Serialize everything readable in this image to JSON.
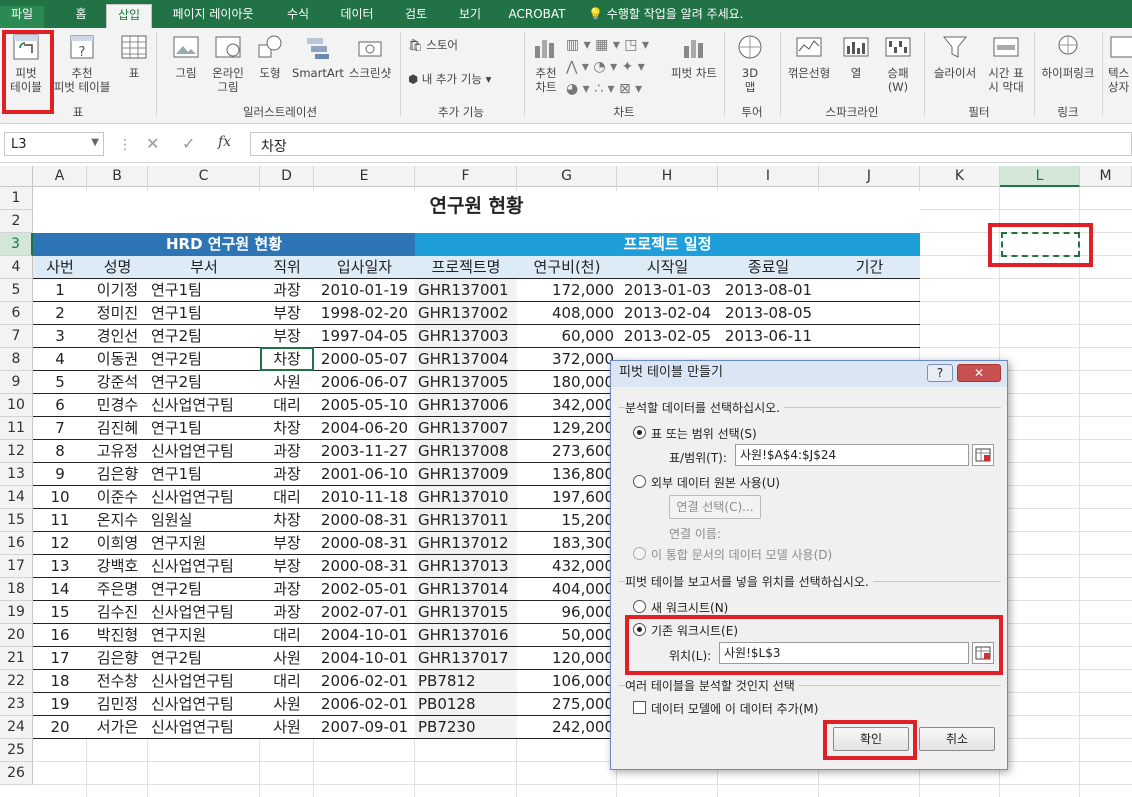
{
  "ribbon_tabs": [
    "파일",
    "홈",
    "삽입",
    "페이지 레이아웃",
    "수식",
    "데이터",
    "검토",
    "보기",
    "ACROBAT"
  ],
  "tell_me": "수행할 작업을 알려 주세요.",
  "ribbon": {
    "pivot": [
      "피벗",
      "테이블"
    ],
    "rec_pivot": [
      "추천",
      "피벗 테이블"
    ],
    "table": "표",
    "picture": "그림",
    "online_picture": [
      "온라인",
      "그림"
    ],
    "shapes": "도형",
    "smartart": "SmartArt",
    "screenshot": "스크린샷",
    "store": "스토어",
    "my_addins": "내 추가 기능",
    "rec_chart": [
      "추천",
      "차트"
    ],
    "pivot_chart": "피벗 차트",
    "map3d": [
      "3D",
      "맵"
    ],
    "spark_line": "꺾은선형",
    "spark_col": "열",
    "spark_wl": [
      "승패",
      "(W)"
    ],
    "slicer": "슬라이서",
    "timeline": [
      "시간 표",
      "시 막대"
    ],
    "hyperlink": "하이퍼링크",
    "text": [
      "텍스",
      "상자"
    ],
    "groups": {
      "tables": "표",
      "illustrations": "일러스트레이션",
      "addins": "추가 기능",
      "charts": "차트",
      "tours": "투어",
      "sparklines": "스파크라인",
      "filters": "필터",
      "links": "링크"
    }
  },
  "formula_bar": {
    "name_box": "L3",
    "formula": "차장"
  },
  "columns": [
    "A",
    "B",
    "C",
    "D",
    "E",
    "F",
    "G",
    "H",
    "I",
    "J",
    "K",
    "L",
    "M"
  ],
  "rows": [
    "1",
    "2",
    "3",
    "4",
    "5",
    "6",
    "7",
    "8",
    "9",
    "10",
    "11",
    "12",
    "13",
    "14",
    "15",
    "16",
    "17",
    "18",
    "19",
    "20",
    "21",
    "22",
    "23",
    "24",
    "25",
    "26"
  ],
  "sheet": {
    "title": "연구원 현황",
    "group_header_left": "HRD 연구원 현황",
    "group_header_right": "프로젝트 일정",
    "headers": [
      "사번",
      "성명",
      "부서",
      "직위",
      "입사일자",
      "프로젝트명",
      "연구비(천)",
      "시작일",
      "종료일",
      "기간"
    ],
    "rows": [
      [
        "1",
        "이기정",
        "연구1팀",
        "과장",
        "2010-01-19",
        "GHR137001",
        "172,000",
        "2013-01-03",
        "2013-08-01"
      ],
      [
        "2",
        "정미진",
        "연구1팀",
        "부장",
        "1998-02-20",
        "GHR137002",
        "408,000",
        "2013-02-04",
        "2013-08-05"
      ],
      [
        "3",
        "경인선",
        "연구2팀",
        "부장",
        "1997-04-05",
        "GHR137003",
        "60,000",
        "2013-02-05",
        "2013-06-11"
      ],
      [
        "4",
        "이동권",
        "연구2팀",
        "차장",
        "2000-05-07",
        "GHR137004",
        "372,000",
        "",
        ""
      ],
      [
        "5",
        "강준석",
        "연구2팀",
        "사원",
        "2006-06-07",
        "GHR137005",
        "180,000",
        "",
        ""
      ],
      [
        "6",
        "민경수",
        "신사업연구팀",
        "대리",
        "2005-05-10",
        "GHR137006",
        "342,000",
        "",
        ""
      ],
      [
        "7",
        "김진혜",
        "연구1팀",
        "차장",
        "2004-06-20",
        "GHR137007",
        "129,200",
        "",
        ""
      ],
      [
        "8",
        "고유정",
        "신사업연구팀",
        "과장",
        "2003-11-27",
        "GHR137008",
        "273,600",
        "",
        ""
      ],
      [
        "9",
        "김은향",
        "연구1팀",
        "과장",
        "2001-06-10",
        "GHR137009",
        "136,800",
        "",
        ""
      ],
      [
        "10",
        "이준수",
        "신사업연구팀",
        "대리",
        "2010-11-18",
        "GHR137010",
        "197,600",
        "",
        ""
      ],
      [
        "11",
        "온지수",
        "임원실",
        "차장",
        "2000-08-31",
        "GHR137011",
        "15,200",
        "",
        ""
      ],
      [
        "12",
        "이희영",
        "연구지원",
        "부장",
        "2000-08-31",
        "GHR137012",
        "183,300",
        "",
        ""
      ],
      [
        "13",
        "강백호",
        "신사업연구팀",
        "부장",
        "2000-08-31",
        "GHR137013",
        "432,000",
        "",
        ""
      ],
      [
        "14",
        "주은명",
        "연구2팀",
        "과장",
        "2002-05-01",
        "GHR137014",
        "404,000",
        "",
        ""
      ],
      [
        "15",
        "김수진",
        "신사업연구팀",
        "과장",
        "2002-07-01",
        "GHR137015",
        "96,000",
        "",
        ""
      ],
      [
        "16",
        "박진형",
        "연구지원",
        "대리",
        "2004-10-01",
        "GHR137016",
        "50,000",
        "",
        ""
      ],
      [
        "17",
        "김은향",
        "연구2팀",
        "사원",
        "2004-10-01",
        "GHR137017",
        "120,000",
        "",
        ""
      ],
      [
        "18",
        "전수창",
        "신사업연구팀",
        "대리",
        "2006-02-01",
        "PB7812",
        "106,000",
        "",
        ""
      ],
      [
        "19",
        "김민정",
        "신사업연구팀",
        "사원",
        "2006-02-01",
        "PB0128",
        "275,000",
        "",
        ""
      ],
      [
        "20",
        "서가은",
        "신사업연구팀",
        "사원",
        "2007-09-01",
        "PB7230",
        "242,000",
        "",
        ""
      ]
    ]
  },
  "dialog": {
    "title": "피벗 테이블 만들기",
    "section1": "분석할 데이터를 선택하십시오.",
    "opt_range": "표 또는 범위 선택(S)",
    "range_label": "표/범위(T):",
    "range_value": "사원!$A$4:$J$24",
    "opt_external": "외부 데이터 원본 사용(U)",
    "conn_button": "연결 선택(C)...",
    "conn_name": "연결 이름:",
    "opt_model": "이 통합 문서의 데이터 모델 사용(D)",
    "section2": "피벗 테이블 보고서를 넣을 위치를 선택하십시오.",
    "opt_new": "새 워크시트(N)",
    "opt_existing": "기존 워크시트(E)",
    "loc_label": "위치(L):",
    "loc_value": "사원!$L$3",
    "section3": "여러 테이블을 분석할 것인지 선택",
    "chk_model": "데이터 모델에 이 데이터 추가(M)",
    "ok": "확인",
    "cancel": "취소",
    "help": "?"
  },
  "colors": {
    "excel_green": "#217346",
    "header_dark": "#2e75b6",
    "header_light": "#1e9fd9",
    "highlight": "#e02027"
  }
}
